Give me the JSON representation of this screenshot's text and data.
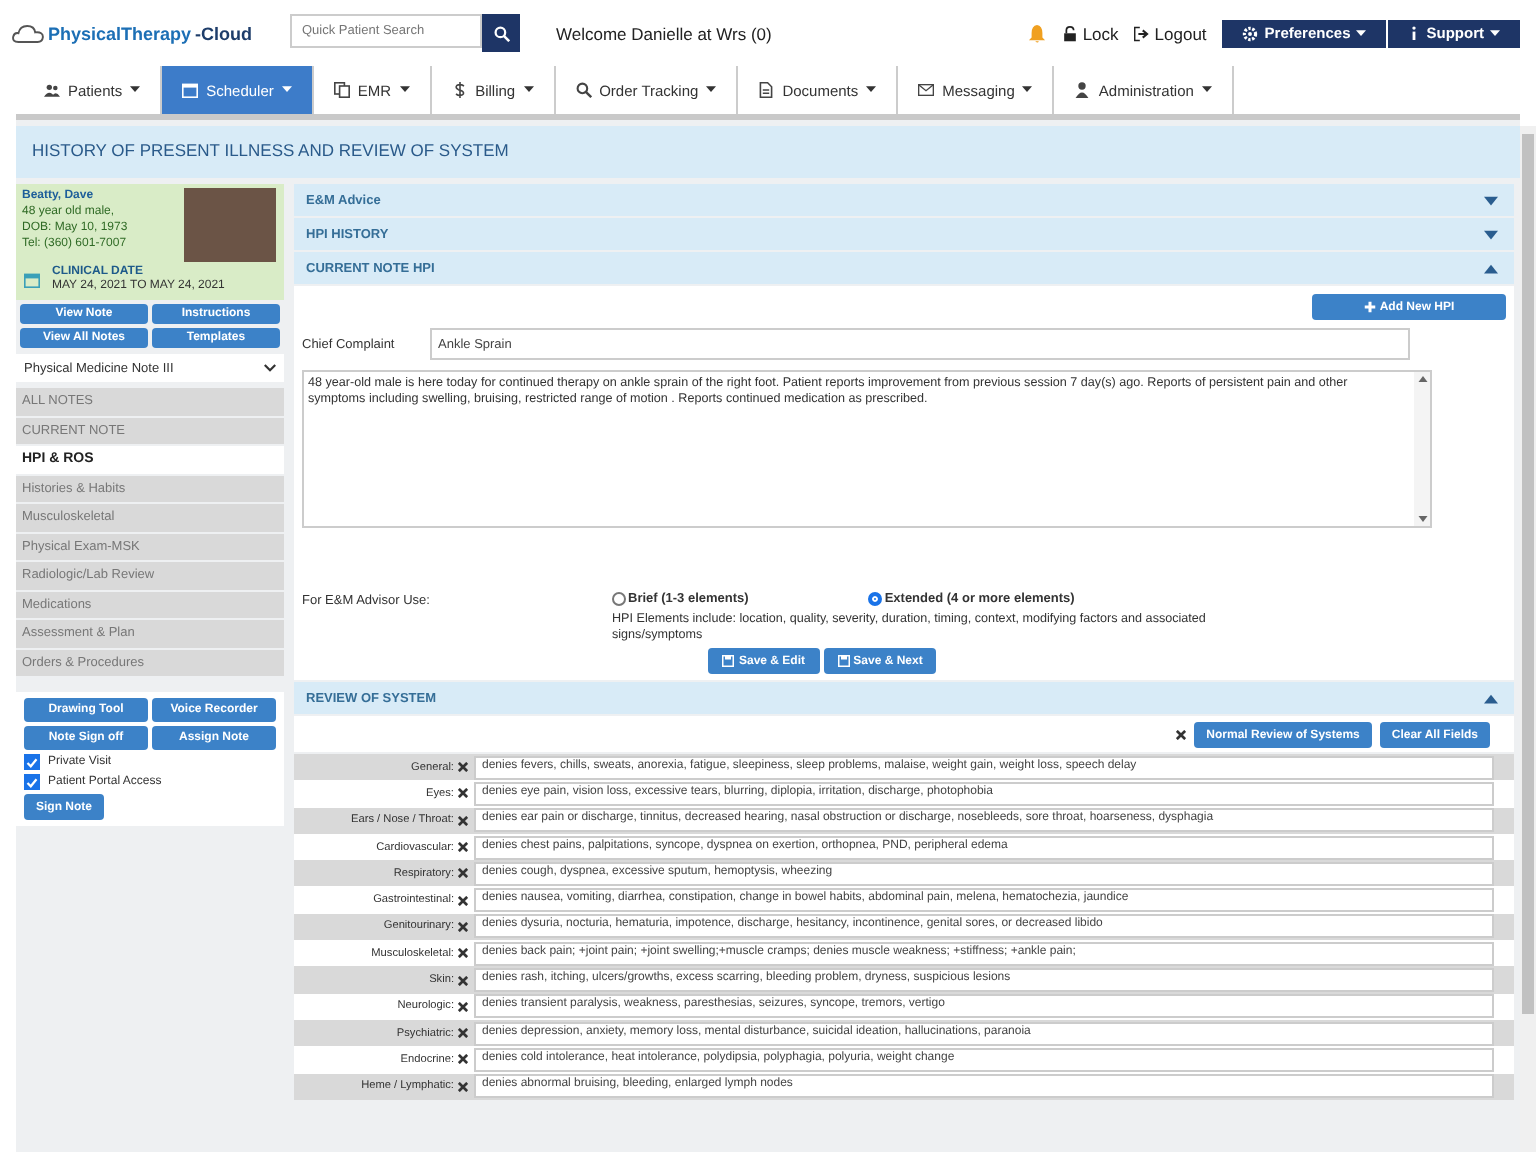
{
  "brand": {
    "name_main": "PhysicalTherapy",
    "name_suffix": "-Cloud"
  },
  "search": {
    "placeholder": "Quick Patient Search"
  },
  "welcome": "Welcome Danielle at Wrs (0)",
  "top_links": [
    {
      "label": "Lock",
      "kind": "lock"
    },
    {
      "label": "Logout",
      "kind": "logout"
    }
  ],
  "top_menus": [
    {
      "label": "Preferences",
      "kind": "gear"
    },
    {
      "label": "Support",
      "kind": "info"
    }
  ],
  "nav": [
    {
      "label": "Patients",
      "kind": "users",
      "selected": false
    },
    {
      "label": "Scheduler",
      "kind": "calendar",
      "selected": true
    },
    {
      "label": "EMR",
      "kind": "copy",
      "selected": false
    },
    {
      "label": "Billing",
      "kind": "dollar",
      "selected": false
    },
    {
      "label": "Order Tracking",
      "kind": "search",
      "selected": false
    },
    {
      "label": "Documents",
      "kind": "file",
      "selected": false
    },
    {
      "label": "Messaging",
      "kind": "mail",
      "selected": false
    },
    {
      "label": "Administration",
      "kind": "user",
      "selected": false
    }
  ],
  "page_title": "HISTORY OF PRESENT ILLNESS AND REVIEW OF SYSTEM",
  "patient": {
    "name": "Beatty, Dave",
    "details": [
      "48 year old male,",
      "DOB: May 10, 1973",
      "Tel: (360) 601-7007"
    ],
    "clinical_date_label": "CLINICAL DATE",
    "clinical_date": "MAY 24, 2021 TO MAY 24, 2021"
  },
  "note_buttons": [
    "View Note",
    "Instructions",
    "View All Notes",
    "Templates"
  ],
  "template_select": {
    "value": "Physical Medicine Note III"
  },
  "sidebar": {
    "items": [
      {
        "label": "ALL NOTES",
        "selected": false
      },
      {
        "label": "CURRENT NOTE",
        "selected": false
      },
      {
        "label": "HPI & ROS",
        "selected": true
      },
      {
        "label": "Histories & Habits",
        "selected": false
      },
      {
        "label": "Musculoskeletal",
        "selected": false
      },
      {
        "label": "Physical Exam-MSK",
        "selected": false
      },
      {
        "label": "Radiologic/Lab Review",
        "selected": false
      },
      {
        "label": "Medications",
        "selected": false
      },
      {
        "label": "Assessment & Plan",
        "selected": false
      },
      {
        "label": "Orders & Procedures",
        "selected": false
      }
    ]
  },
  "action_buttons": [
    "Drawing Tool",
    "Voice Recorder",
    "Note Sign off",
    "Assign Note"
  ],
  "checkboxes": [
    {
      "label": "Private Visit",
      "checked": true
    },
    {
      "label": "Patient Portal Access",
      "checked": true
    }
  ],
  "sign_button": "Sign Note",
  "sections": [
    {
      "title": "E&M Advice",
      "expanded": false
    },
    {
      "title": "HPI HISTORY",
      "expanded": false
    },
    {
      "title": "CURRENT NOTE HPI",
      "expanded": true
    }
  ],
  "hpi": {
    "add_button": "Add New HPI",
    "chief_complaint_label": "Chief Complaint",
    "chief_complaint": "Ankle Sprain",
    "narrative": "48 year-old  male is here today for continued therapy on ankle sprain of the right foot. Patient reports improvement from previous session 7  day(s) ago. Reports of persistent pain and other symptoms including swelling, bruising, restricted range of motion . Reports continued medication as prescribed.",
    "advisor_label": "For E&M Advisor Use:",
    "options": [
      {
        "label": "Brief (1-3 elements)",
        "selected": false
      },
      {
        "label": "Extended (4 or more elements)",
        "selected": true
      }
    ],
    "elements_note": "HPI Elements include: location, quality, severity, duration, timing, context, modifying factors and associated signs/symptoms",
    "buttons": [
      "Save & Edit",
      "Save & Next"
    ]
  },
  "ros": {
    "title": "REVIEW OF SYSTEM",
    "expanded": true,
    "buttons": [
      "Normal Review of Systems",
      "Clear All Fields"
    ],
    "rows": [
      {
        "label": "General:",
        "value": "denies fevers, chills, sweats, anorexia, fatigue, sleepiness, sleep problems, malaise, weight gain, weight loss, speech delay"
      },
      {
        "label": "Eyes:",
        "value": "denies eye pain, vision loss, excessive tears, blurring, diplopia, irritation, discharge, photophobia"
      },
      {
        "label": "Ears / Nose / Throat:",
        "value": "denies ear pain or discharge, tinnitus, decreased hearing, nasal obstruction or discharge, nosebleeds, sore throat, hoarseness, dysphagia"
      },
      {
        "label": "Cardiovascular:",
        "value": "denies chest pains, palpitations, syncope, dyspnea on exertion, orthopnea, PND, peripheral edema"
      },
      {
        "label": "Respiratory:",
        "value": "denies cough, dyspnea, excessive sputum, hemoptysis, wheezing"
      },
      {
        "label": "Gastrointestinal:",
        "value": "denies nausea, vomiting, diarrhea, constipation, change in bowel habits, abdominal pain, melena, hematochezia, jaundice"
      },
      {
        "label": "Genitourinary:",
        "value": "denies dysuria, nocturia, hematuria, impotence, discharge, hesitancy, incontinence, genital sores, or decreased libido"
      },
      {
        "label": "Musculoskeletal:",
        "value": "denies back pain;  +joint pain;  +joint swelling;+muscle cramps; denies muscle weakness; +stiffness; +ankle pain;"
      },
      {
        "label": "Skin:",
        "value": "denies rash, itching, ulcers/growths, excess scarring, bleeding problem, dryness, suspicious lesions"
      },
      {
        "label": "Neurologic:",
        "value": "denies transient paralysis, weakness, paresthesias, seizures, syncope, tremors, vertigo"
      },
      {
        "label": "Psychiatric:",
        "value": "denies depression, anxiety, memory loss, mental disturbance, suicidal ideation, hallucinations, paranoia"
      },
      {
        "label": "Endocrine:",
        "value": "denies cold intolerance, heat intolerance, polydipsia, polyphagia, polyuria, weight change"
      },
      {
        "label": "Heme / Lymphatic:",
        "value": "denies abnormal bruising, bleeding, enlarged lymph nodes"
      }
    ]
  }
}
